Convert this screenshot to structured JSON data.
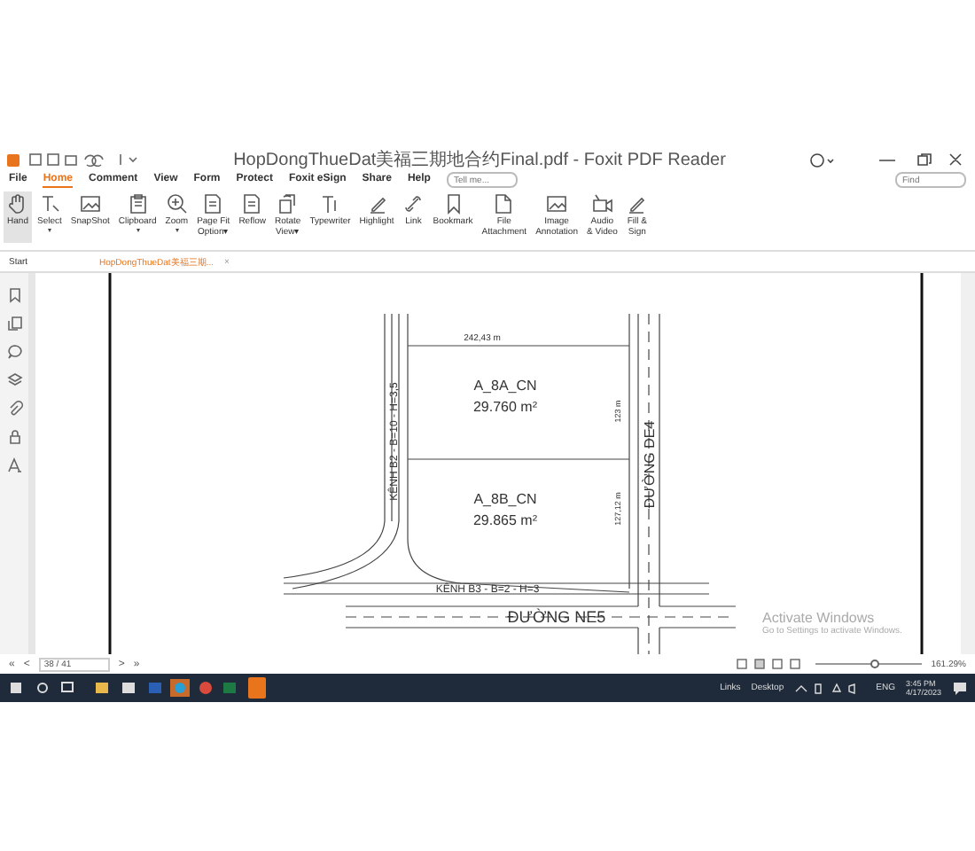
{
  "window": {
    "title": "HopDongThueDat美福三期地合约Final.pdf - Foxit PDF Reader"
  },
  "menu": [
    {
      "label": "File",
      "selected": false
    },
    {
      "label": "Home",
      "selected": true
    },
    {
      "label": "Comment",
      "selected": false
    },
    {
      "label": "View",
      "selected": false
    },
    {
      "label": "Form",
      "selected": false
    },
    {
      "label": "Protect",
      "selected": false
    },
    {
      "label": "Foxit eSign",
      "selected": false
    },
    {
      "label": "Share",
      "selected": false
    },
    {
      "label": "Help",
      "selected": false
    }
  ],
  "tell_me": {
    "placeholder": "Tell me..."
  },
  "find": {
    "placeholder": "Find"
  },
  "ribbon": [
    {
      "label": "Hand",
      "kind": "hand",
      "selected": true,
      "dropdown": false
    },
    {
      "label": "Select",
      "kind": "cursor",
      "selected": false,
      "dropdown": true
    },
    {
      "label": "SnapShot",
      "kind": "image",
      "selected": false,
      "dropdown": false
    },
    {
      "label": "Clipboard",
      "kind": "clipboard",
      "selected": false,
      "dropdown": true
    },
    {
      "label": "Zoom",
      "kind": "zoom",
      "selected": false,
      "dropdown": true
    },
    {
      "label": "Page Fit\nOption▾",
      "kind": "page",
      "selected": false,
      "dropdown": false
    },
    {
      "label": "Reflow",
      "kind": "page",
      "selected": false,
      "dropdown": false
    },
    {
      "label": "Rotate\nView▾",
      "kind": "rotate",
      "selected": false,
      "dropdown": false
    },
    {
      "label": "Typewriter",
      "kind": "text",
      "selected": false,
      "dropdown": false
    },
    {
      "label": "Highlight",
      "kind": "pen",
      "selected": false,
      "dropdown": false
    },
    {
      "label": "Link",
      "kind": "link",
      "selected": false,
      "dropdown": false
    },
    {
      "label": "Bookmark",
      "kind": "bookmark",
      "selected": false,
      "dropdown": false
    },
    {
      "label": "File\nAttachment",
      "kind": "file",
      "selected": false,
      "dropdown": false
    },
    {
      "label": "Image\nAnnotation",
      "kind": "image",
      "selected": false,
      "dropdown": false
    },
    {
      "label": "Audio\n& Video",
      "kind": "video",
      "selected": false,
      "dropdown": false
    },
    {
      "label": "Fill &\nSign",
      "kind": "pen",
      "selected": false,
      "dropdown": false
    }
  ],
  "tabs": [
    {
      "label": "Start",
      "selected": false,
      "closable": false
    },
    {
      "label": "HopDongThueDat美福三期...",
      "selected": true,
      "closable": true
    }
  ],
  "close_mark": "×",
  "map": {
    "width_label": "242,43 m",
    "plots": [
      {
        "name": "A_8A_CN",
        "area": "29.760 m²",
        "side": "123 m"
      },
      {
        "name": "A_8B_CN",
        "area": "29.865 m²",
        "side": "127,12 m"
      }
    ],
    "canal_b2": "KÊNH B2 - B=10 - H=3,5",
    "canal_b3": "KÊNH B3 - B=2 - H=3",
    "road_de4": "ĐƯỜNG DE4",
    "road_ne5": "ĐƯỜNG NE5"
  },
  "activation": {
    "title": "Activate Windows",
    "hint": "Go to Settings to activate Windows."
  },
  "status": {
    "first": "«",
    "prev": "<",
    "page": "38 / 41",
    "next": ">",
    "last": "»",
    "level": 0.55,
    "zoom": "161.29%"
  },
  "taskbar": {
    "links": "Links",
    "desktop": "Desktop",
    "language": "ENG",
    "time": "3:45 PM",
    "date": "4/17/2023"
  }
}
